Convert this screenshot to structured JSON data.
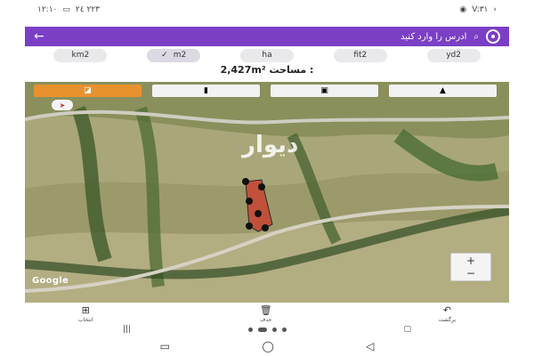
{
  "status_bar": {
    "time": "۱۲:۱۰",
    "left_info": "۲٤ ۲۲۳",
    "right_time": "V:۳۱"
  },
  "toolbar": {
    "search_placeholder": "ادرس را وارد کنید"
  },
  "units": [
    {
      "label": "km2",
      "selected": false
    },
    {
      "label": "m2",
      "selected": true
    },
    {
      "label": "ha",
      "selected": false
    },
    {
      "label": "fit2",
      "selected": false
    },
    {
      "label": "yd2",
      "selected": false
    }
  ],
  "area": {
    "label": "مساحت :",
    "value": "2,427m²"
  },
  "map": {
    "watermark": "دیوار",
    "attribution": "Google",
    "zoom_in": "+",
    "zoom_out": "−"
  },
  "bottom_actions": [
    {
      "label": "انتخاب"
    },
    {
      "label": "حذف"
    },
    {
      "label": "برگشت"
    }
  ],
  "colors": {
    "accent": "#7b3fc6",
    "tool_active": "#e8922f"
  }
}
